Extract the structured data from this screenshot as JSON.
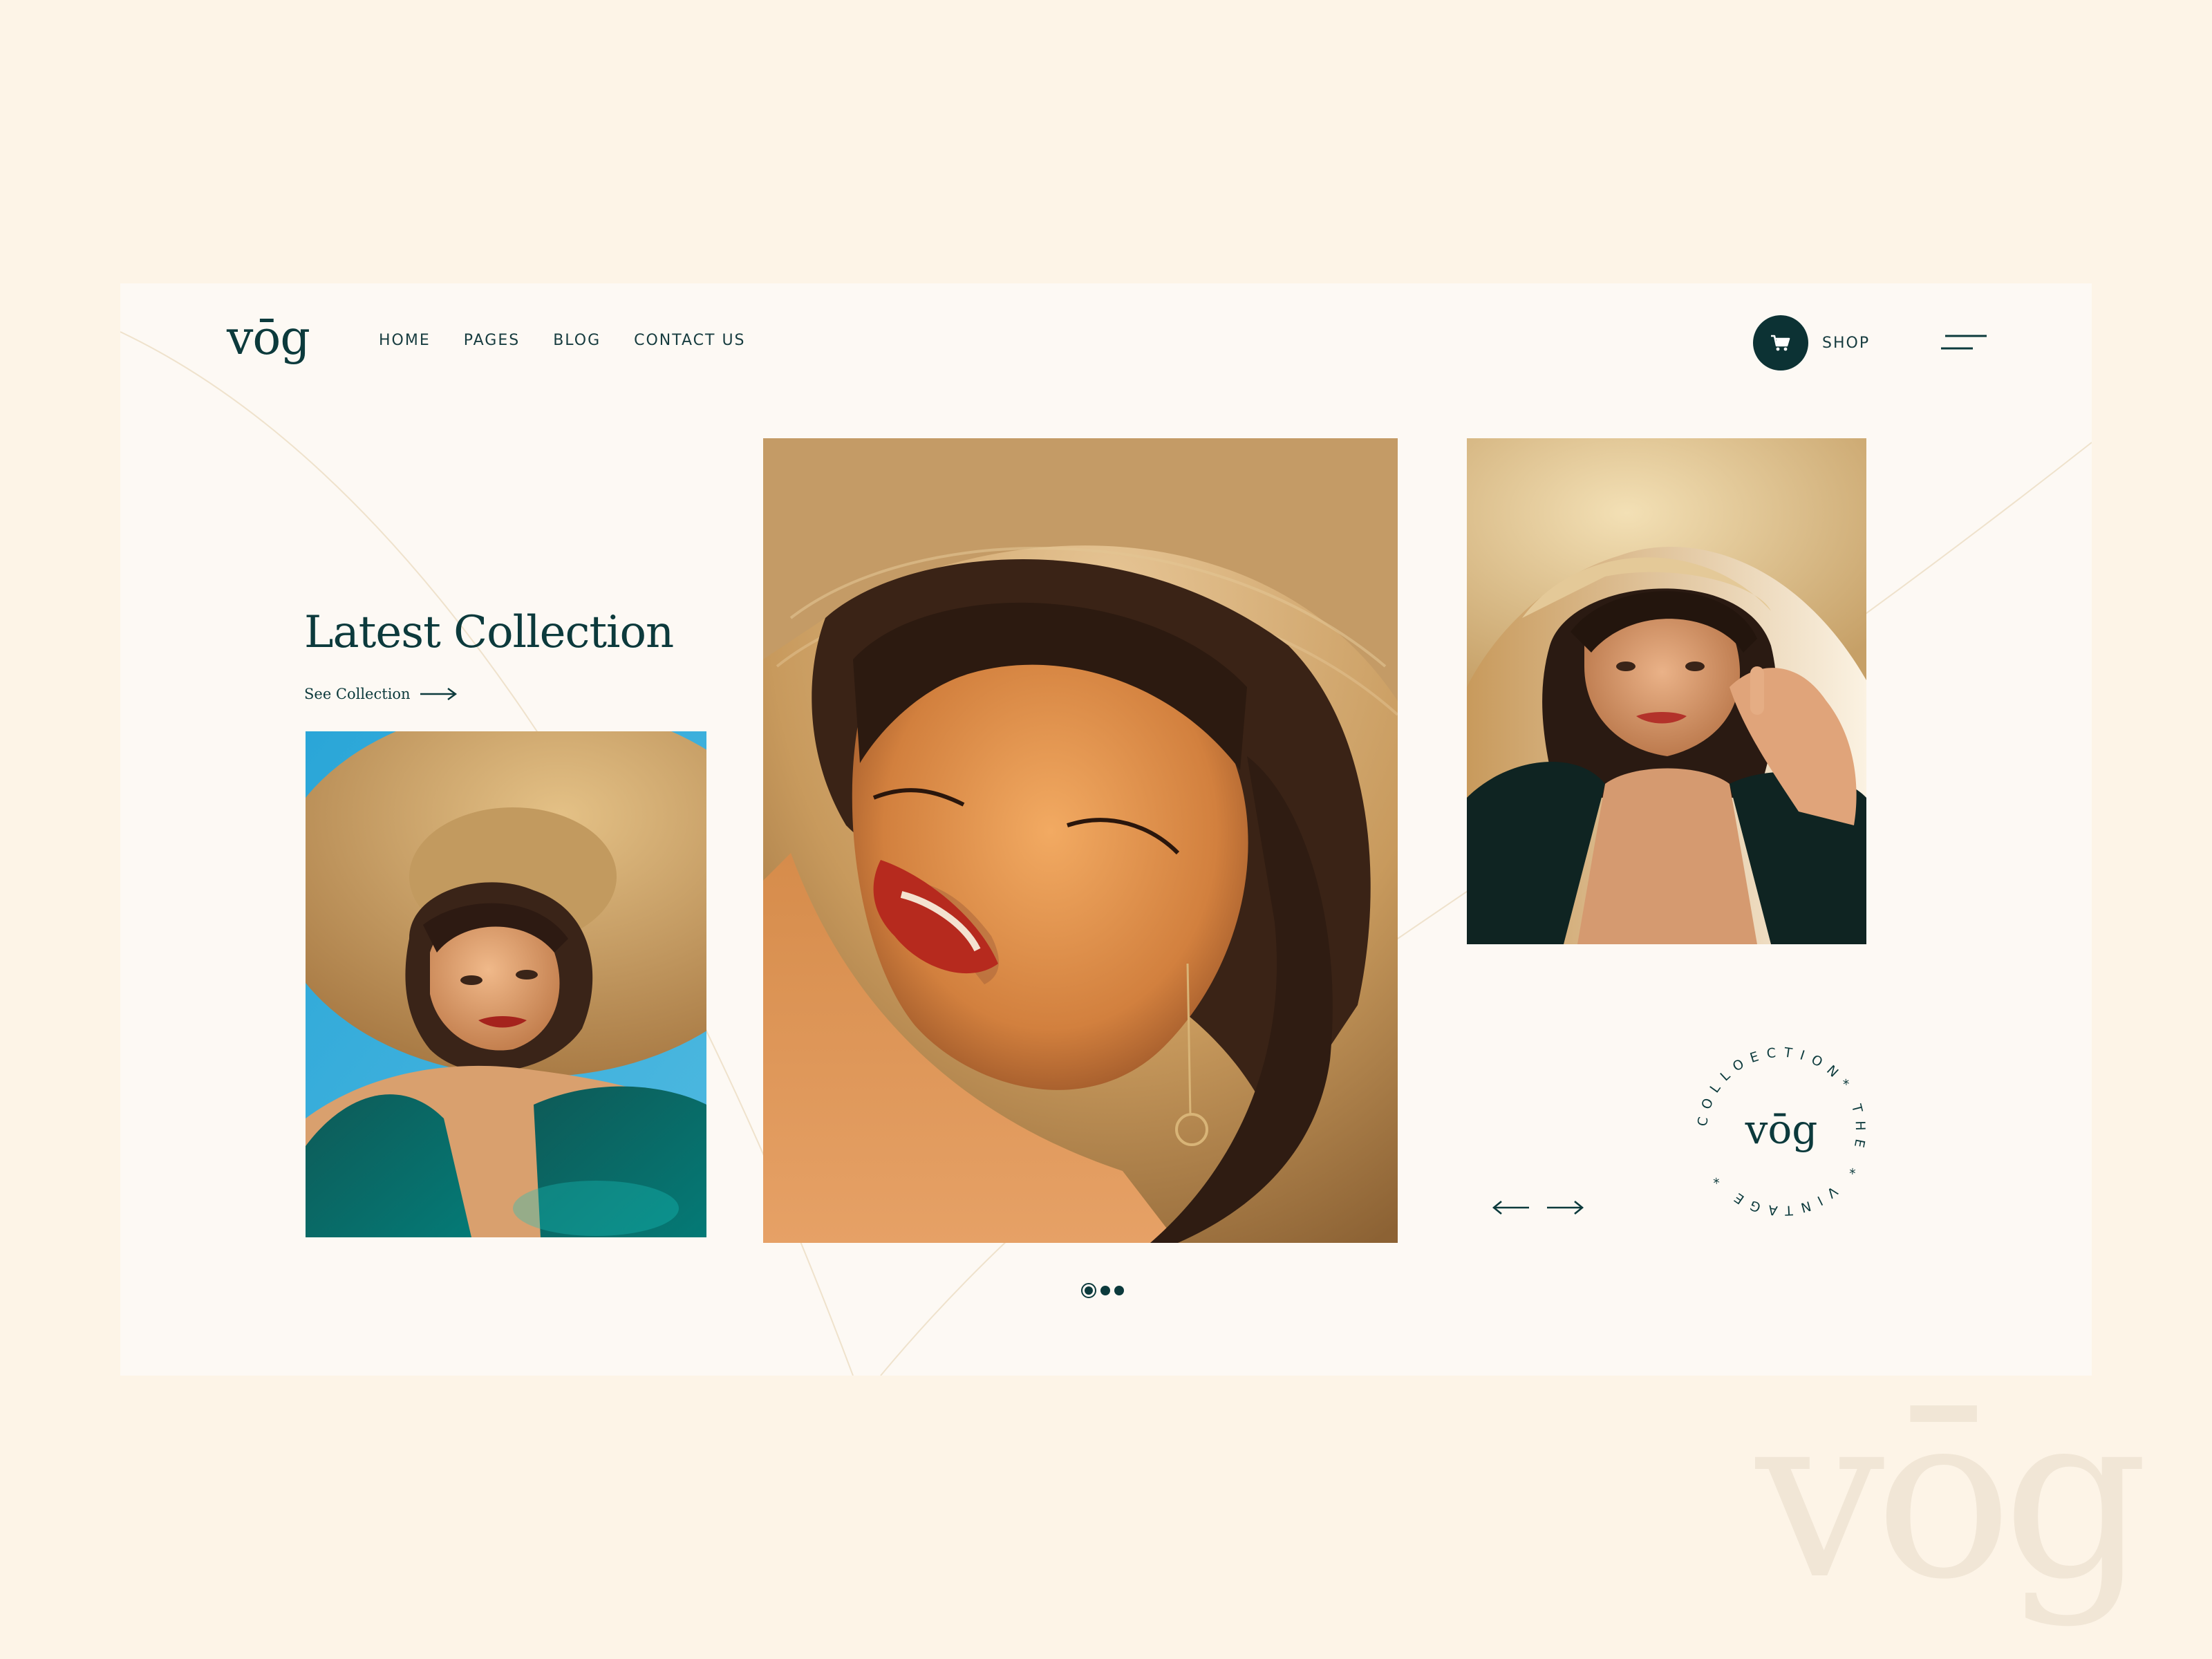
{
  "brand": {
    "logo": "vōg",
    "watermark": "vōg"
  },
  "nav": {
    "items": [
      "HOME",
      "PAGES",
      "BLOG",
      "CONTACT US"
    ]
  },
  "header": {
    "shop_label": "SHOP",
    "cart_icon": "cart-icon",
    "menu_icon": "menu-icon"
  },
  "hero": {
    "title": "Latest Collection",
    "link_label": "See Collection",
    "link_icon": "arrow-right-icon"
  },
  "badge": {
    "ring_text": "COLLOECTION* THE * VINTAGE * ",
    "logo": "vōg"
  },
  "carousel": {
    "prev_icon": "arrow-left-icon",
    "next_icon": "arrow-right-icon",
    "pages": 3,
    "active_page": 1
  },
  "colors": {
    "page_bg": "#fdf4e7",
    "card_bg": "#fdf9f4",
    "accent": "#0c3a3c"
  }
}
